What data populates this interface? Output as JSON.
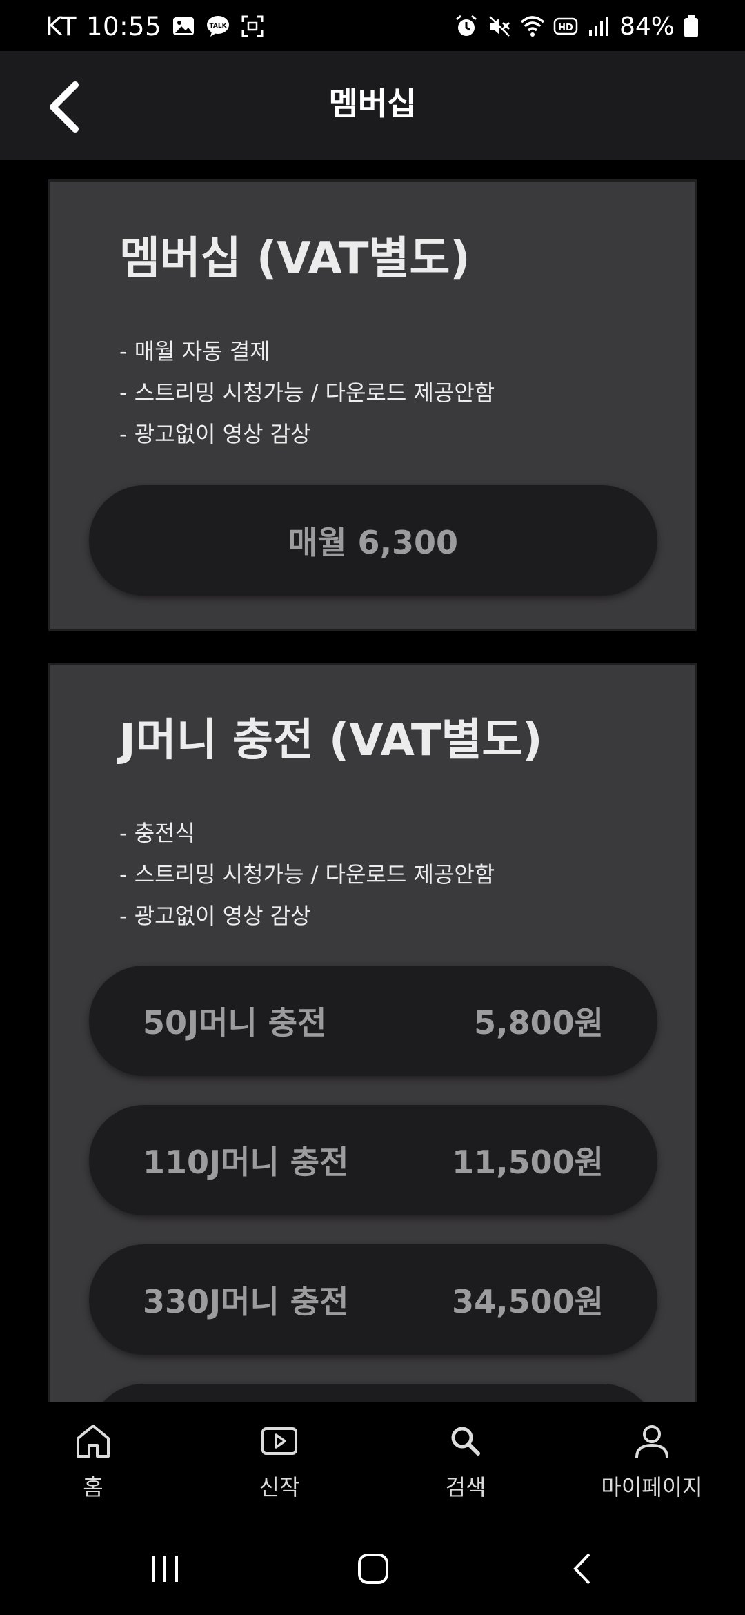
{
  "status_bar": {
    "carrier": "KT",
    "time": "10:55",
    "battery_percent": "84%",
    "left_icons": [
      "gallery-icon",
      "kakaotalk-icon",
      "screenshot-icon"
    ],
    "right_icons": [
      "alarm-icon",
      "mute-icon",
      "wifi-icon",
      "hd-icon",
      "signal-icon",
      "battery-icon"
    ]
  },
  "header": {
    "title": "멤버십",
    "back_icon": "chevron-left-icon"
  },
  "membership_card": {
    "title": "멤버십 (VAT별도)",
    "features": [
      "- 매월 자동 결제",
      "- 스트리밍 시청가능 / 다운로드 제공안함",
      "- 광고없이 영상 감상"
    ],
    "price_label": "매월 6,300"
  },
  "jmoney_card": {
    "title": "J머니 충전 (VAT별도)",
    "features": [
      "- 충전식",
      "- 스트리밍 시청가능 / 다운로드 제공안함",
      "- 광고없이 영상 감상"
    ],
    "options": [
      {
        "name": "50J머니 충전",
        "price": "5,800원"
      },
      {
        "name": "110J머니 충전",
        "price": "11,500원"
      },
      {
        "name": "330J머니 충전",
        "price": "34,500원"
      }
    ]
  },
  "bottom_nav": {
    "items": [
      {
        "label": "홈",
        "icon": "home-icon"
      },
      {
        "label": "신작",
        "icon": "play-icon"
      },
      {
        "label": "검색",
        "icon": "search-icon"
      },
      {
        "label": "마이페이지",
        "icon": "user-icon"
      }
    ]
  },
  "colors": {
    "background": "#000000",
    "header": "#1b1a1c",
    "card": "#3a393c",
    "button": "#1c1b1e",
    "button_text": "#9c9c9e"
  }
}
